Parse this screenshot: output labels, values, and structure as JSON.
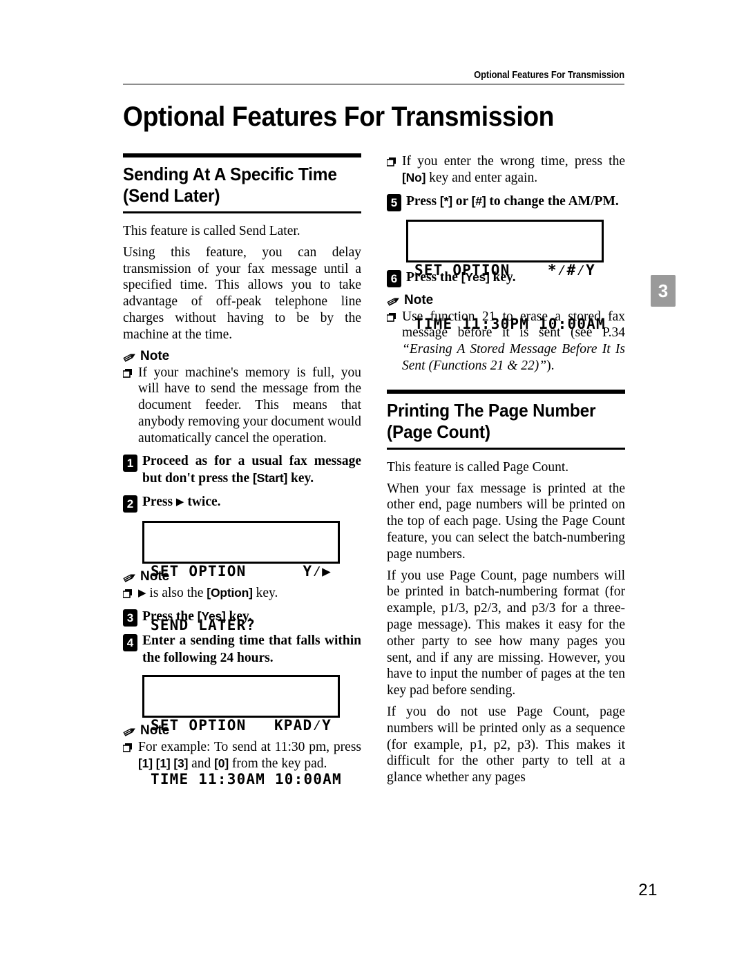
{
  "header": {
    "running_head": "Optional Features For Transmission"
  },
  "chapter": {
    "title": "Optional Features For Transmission",
    "tab_number": "3",
    "page_number": "21"
  },
  "sections": {
    "send_later": {
      "title_line1": "Sending At A Specific Time",
      "title_line2": "(Send Later)",
      "intro": "This feature is called Send Later.",
      "description": "Using this feature, you can delay transmission of your fax message until a specified time. This allows you to take advantage of off-peak telephone line charges without having to be by the machine at the time.",
      "note_label": "Note",
      "note_1": "If your machine's memory is full, you will have to send the message from the document feeder. This means that anybody removing your document would automatically cancel the operation.",
      "step_1_a": "Proceed as for a usual fax message but don't press the ",
      "step_1_key": "Start",
      "step_1_b": " key.",
      "step_2_a": "Press ",
      "step_2_arrow": "▶",
      "step_2_b": " twice.",
      "lcd_1": {
        "line1_left": "SET OPTION",
        "line1_right": "Y⁄▶",
        "line2_left": "SEND LATER?",
        "line2_right": ""
      },
      "note_label_2": "Note",
      "note_2_arrow": "▶",
      "note_2_a": " is also the ",
      "note_2_key": "Option",
      "note_2_b": " key.",
      "step_3_a": "Press the ",
      "step_3_key": "Yes",
      "step_3_b": " key.",
      "step_4": "Enter a sending time that falls within the following 24 hours.",
      "lcd_2": {
        "line1_left": "SET OPTION",
        "line1_right": "KPAD⁄Y",
        "line2_left": "TIME 11:30AM 10:00AM",
        "line2_right": ""
      },
      "note_label_3": "Note",
      "note_3_a": "For example: To send at 11:30 pm, press ",
      "note_3_key1": "1",
      "note_3_key2": "1",
      "note_3_key3": "3",
      "note_3_mid": " and ",
      "note_3_key4": "0",
      "note_3_b": " from the key pad.",
      "note_4_a": "If you enter the wrong time, press the ",
      "note_4_key": "No",
      "note_4_b": " key and enter again.",
      "step_5_a": "Press ",
      "step_5_key1": "*",
      "step_5_mid": " or ",
      "step_5_key2": "#",
      "step_5_b": " to change the AM/PM.",
      "lcd_3": {
        "line1_left": "SET OPTION",
        "line1_right": "*⁄#⁄Y",
        "line2_left": "TIME 11:30PM 10:00AM",
        "line2_right": ""
      },
      "step_6_a": "Press the ",
      "step_6_key": "Yes",
      "step_6_b": " key.",
      "note_label_4": "Note",
      "note_5_a": "Use function 21 to erase a stored fax message before it is sent (see P.34 ",
      "note_5_italic": "“Erasing A Stored Message Before It Is Sent (Functions 21 & 22)”",
      "note_5_b": ")."
    },
    "page_count": {
      "title_line1": "Printing The Page Number",
      "title_line2": "(Page Count)",
      "intro": "This feature is called Page Count.",
      "para_1": "When your fax message is printed at the other end, page numbers will be printed on the top of each page. Using the Page Count feature, you can select the batch-numbering page numbers.",
      "para_2": "If you use Page Count, page numbers will be printed in batch-numbering format (for example, p1/3, p2/3, and p3/3 for a three-page message). This makes it easy for the other party to see how many pages you sent, and if any are missing. However, you have to input the number of pages at the ten key pad before sending.",
      "para_3": "If you do not use Page Count, page numbers will be printed only as a sequence (for example, p1, p2, p3). This makes it difficult for the other party to tell at a glance whether any pages"
    }
  },
  "colors": {
    "rule_gray": "#8d8d8d",
    "tab_gray": "#9a9a9a",
    "ink": "#000000",
    "paper": "#ffffff"
  }
}
